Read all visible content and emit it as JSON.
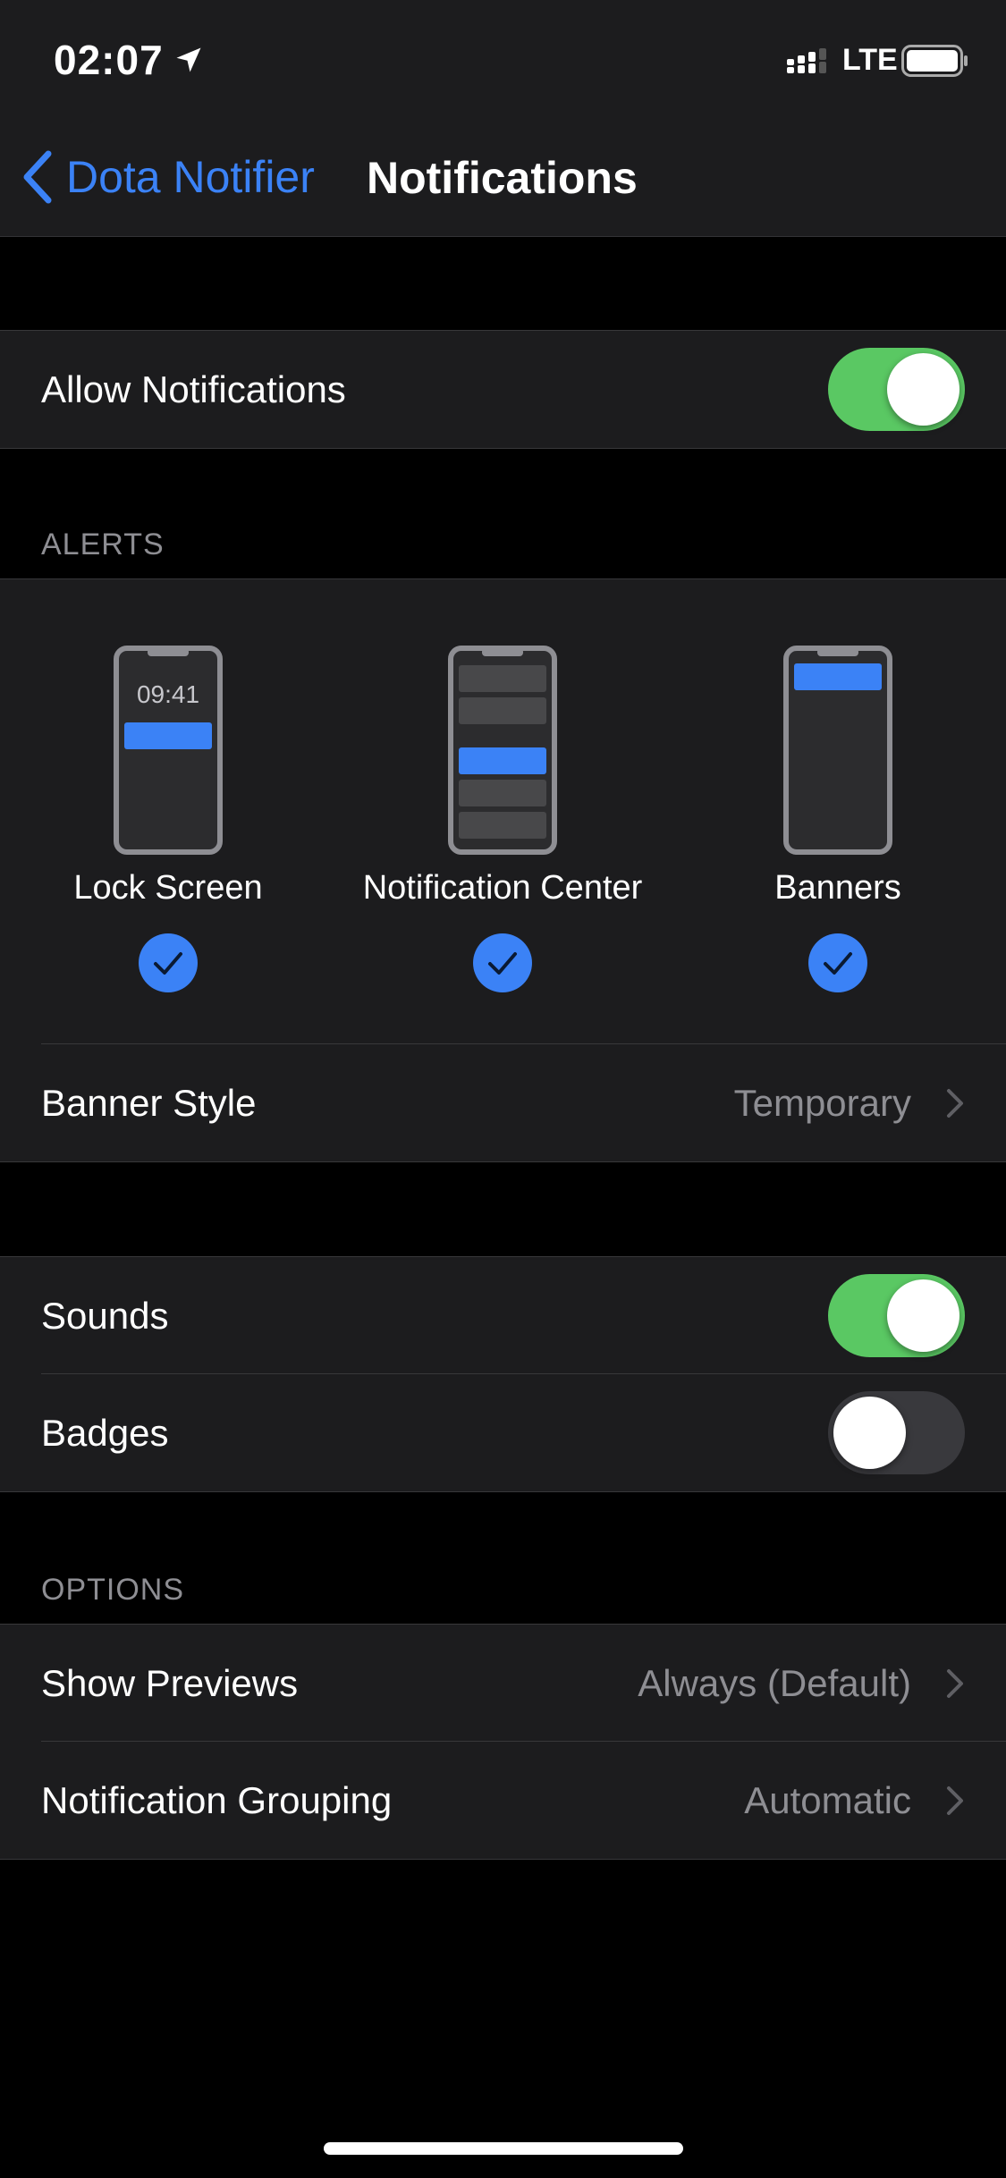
{
  "status_bar": {
    "time": "02:07",
    "network": "LTE",
    "icons": [
      "location-arrow-icon",
      "signal-bars-icon",
      "battery-icon"
    ]
  },
  "nav": {
    "back_label": "Dota Notifier",
    "title": "Notifications"
  },
  "allow": {
    "label": "Allow Notifications",
    "enabled": true
  },
  "alerts": {
    "header": "ALERTS",
    "phone_time": "09:41",
    "items": [
      {
        "label": "Lock Screen",
        "checked": true
      },
      {
        "label": "Notification Center",
        "checked": true
      },
      {
        "label": "Banners",
        "checked": true
      }
    ],
    "banner_style": {
      "label": "Banner Style",
      "value": "Temporary"
    }
  },
  "sounds": {
    "label": "Sounds",
    "enabled": true
  },
  "badges": {
    "label": "Badges",
    "enabled": false
  },
  "options": {
    "header": "OPTIONS",
    "show_previews": {
      "label": "Show Previews",
      "value": "Always (Default)"
    },
    "grouping": {
      "label": "Notification Grouping",
      "value": "Automatic"
    }
  },
  "colors": {
    "accent": "#3b82f6",
    "toggle_on": "#5ac863",
    "toggle_off": "#39393d",
    "group_bg": "#1c1c1e",
    "secondary_text": "#8e8e93"
  }
}
